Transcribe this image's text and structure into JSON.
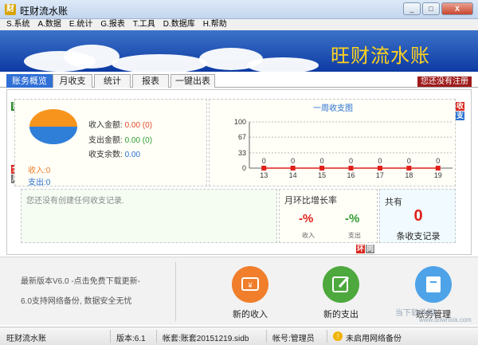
{
  "window": {
    "icon_text": "财",
    "title": "旺财流水账",
    "buttons": [
      "_",
      "□",
      "X"
    ]
  },
  "menu": [
    "S.系统",
    "A.数据",
    "E.统计",
    "G.报表",
    "T.工具",
    "D.数据库",
    "H.帮助"
  ],
  "banner": {
    "title": "旺财流水账"
  },
  "tabs": [
    "账务概览",
    "月收支",
    "统计",
    "报表",
    "一键出表"
  ],
  "register_notice": "您还没有注册",
  "left_tags": {
    "top": "日",
    "mid": "全",
    "bottom": "月"
  },
  "right_tags": {
    "income": "收",
    "expense": "支",
    "bottom1": "环",
    "bottom2": "同"
  },
  "summary": {
    "income_label": "收入金额:",
    "income_value": "0.00 (0)",
    "expense_label": "支出金额:",
    "expense_value": "0.00 (0)",
    "balance_label": "收支余数:",
    "balance_value": "0.00",
    "income_count": "收入:0",
    "expense_count": "支出:0",
    "pie_colors": [
      "#f7941d",
      "#2f7fd9"
    ]
  },
  "chart_data": {
    "type": "line",
    "title": "一周收支图",
    "x": [
      "13",
      "14",
      "15",
      "16",
      "17",
      "18",
      "19"
    ],
    "values": [
      0,
      0,
      0,
      0,
      0,
      0,
      0
    ],
    "point_labels": [
      "0",
      "0",
      "0",
      "0",
      "0",
      "0",
      "0"
    ],
    "y_ticks": [
      "100",
      "67",
      "33",
      "0"
    ],
    "ylim": [
      0,
      100
    ],
    "grid": true,
    "marker_color": "#e0201b"
  },
  "records": {
    "empty_text": "您还没有创建任何收支记录."
  },
  "growth": {
    "title": "月环比增长率",
    "income_value": "-%",
    "income_label": "收入",
    "expense_value": "-%",
    "expense_label": "支出"
  },
  "total": {
    "title": "共有",
    "count": "0",
    "caption": "条收支记录"
  },
  "news": {
    "line1": "最新版本V6.0  -点击免费下载更新-",
    "line2": "6.0支持网络备份, 数据安全无忧"
  },
  "actions": {
    "new_income": {
      "label": "新的收入",
      "color": "#f07e2b",
      "icon": "wallet-icon"
    },
    "new_expense": {
      "label": "新的支出",
      "color": "#4da83d",
      "icon": "edit-icon"
    },
    "account_mgmt": {
      "label": "账务管理",
      "color": "#4ea3e8",
      "icon": "folder-icon"
    }
  },
  "watermark": {
    "text1": "当下软件园",
    "text2": "www.downxia.com"
  },
  "status": {
    "app": "旺财流水账",
    "version": "版本:6.1",
    "book": "帐套:账套20151219.sidb",
    "user": "帐号:管理员",
    "backup": "未启用网络备份"
  }
}
